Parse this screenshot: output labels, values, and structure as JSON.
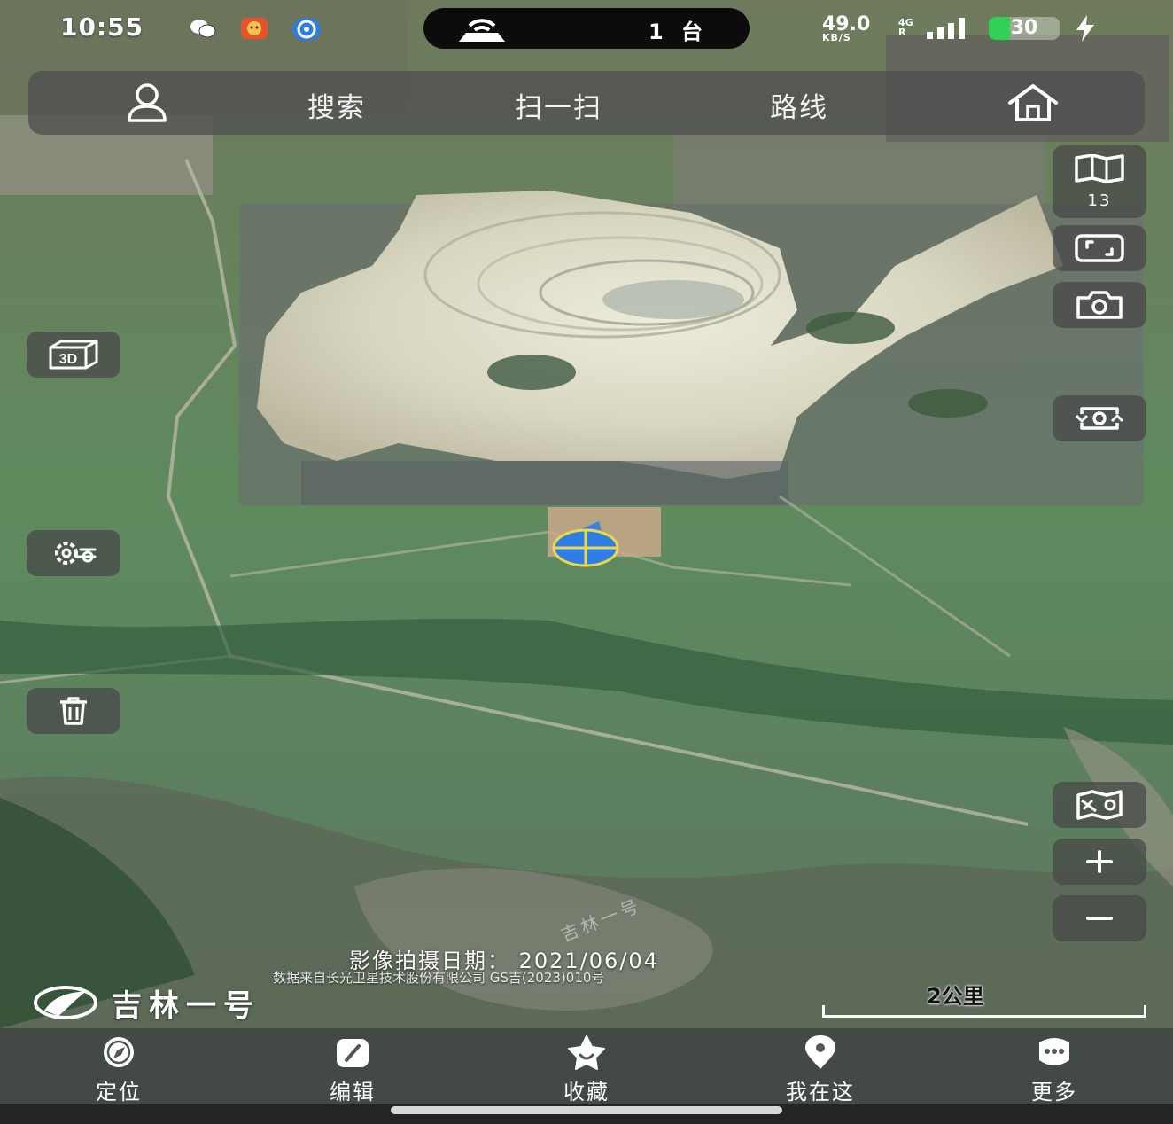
{
  "status_bar": {
    "time": "10:55",
    "device_count": "1 台",
    "net_speed": "49.0",
    "net_unit": "KB/S",
    "signal_label": "4G",
    "signal_sub": "R",
    "battery_level": "30",
    "battery_fraction": 0.3
  },
  "toolbar": {
    "search_label": "搜索",
    "scan_label": "扫一扫",
    "route_label": "路线"
  },
  "map": {
    "zoom_level": "13",
    "watermark": "吉林一号",
    "image_date": "影像拍摄日期： 2021/06/04",
    "data_source": "数据来自长光卫星技术股份有限公司 GS吉(2023)010号",
    "brand_name": "吉林一号",
    "scale_label": "2公里"
  },
  "bottom_nav": {
    "items": [
      {
        "label": "定位",
        "icon": "compass-icon"
      },
      {
        "label": "编辑",
        "icon": "edit-icon"
      },
      {
        "label": "收藏",
        "icon": "star-icon"
      },
      {
        "label": "我在这",
        "icon": "location-pin-icon"
      },
      {
        "label": "更多",
        "icon": "more-icon"
      }
    ]
  },
  "colors": {
    "accent_blue": "#2f7ee8",
    "toolbar_bg": "#505050",
    "battery_green": "#31d158"
  }
}
